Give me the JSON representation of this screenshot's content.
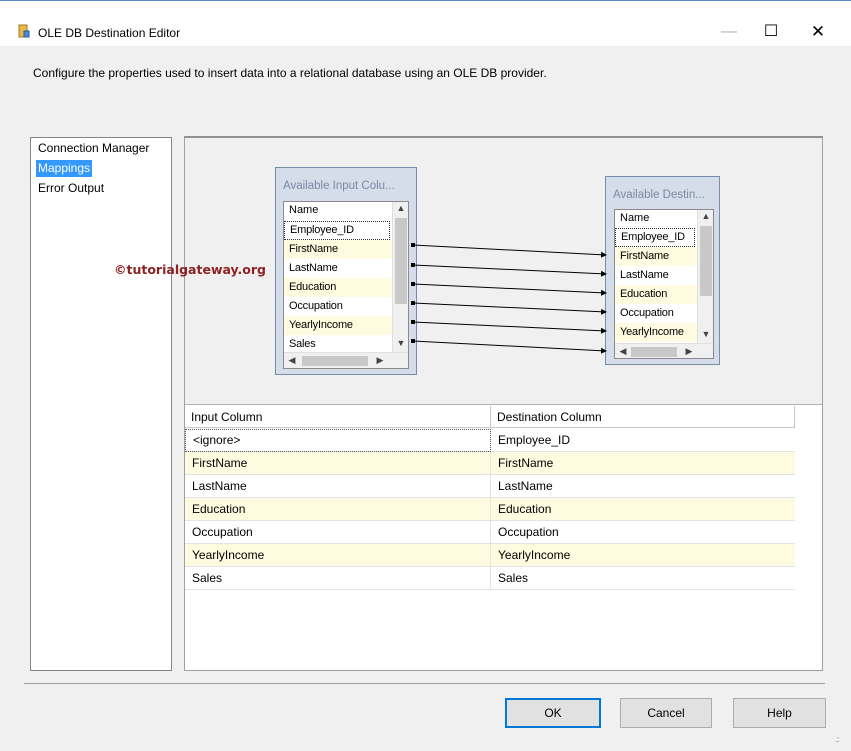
{
  "window": {
    "title": "OLE DB Destination Editor",
    "minimize_glyph": "—",
    "maximize_glyph": "☐",
    "close_glyph": "✕",
    "icon": "ssis-destination-icon"
  },
  "description": "Configure the properties used to insert data into a relational database using an OLE DB provider.",
  "nav": {
    "items": [
      {
        "label": "Connection Manager"
      },
      {
        "label": "Mappings",
        "selected": true
      },
      {
        "label": "Error Output"
      }
    ]
  },
  "watermark": "©tutorialgateway.org",
  "input_box": {
    "title": "Available Input Colu...",
    "header": "Name",
    "rows": [
      "Employee_ID",
      "FirstName",
      "LastName",
      "Education",
      "Occupation",
      "YearlyIncome",
      "Sales"
    ]
  },
  "dest_box": {
    "title": "Available Destin...",
    "header": "Name",
    "rows": [
      "Employee_ID",
      "FirstName",
      "LastName",
      "Education",
      "Occupation",
      "YearlyIncome"
    ]
  },
  "grid": {
    "headers": {
      "input": "Input Column",
      "destination": "Destination Column"
    },
    "rows": [
      {
        "input": "<ignore>",
        "destination": "Employee_ID"
      },
      {
        "input": "FirstName",
        "destination": "FirstName"
      },
      {
        "input": "LastName",
        "destination": "LastName"
      },
      {
        "input": "Education",
        "destination": "Education"
      },
      {
        "input": "Occupation",
        "destination": "Occupation"
      },
      {
        "input": "YearlyIncome",
        "destination": "YearlyIncome"
      },
      {
        "input": "Sales",
        "destination": "Sales"
      }
    ]
  },
  "buttons": {
    "ok": "OK",
    "cancel": "Cancel",
    "help": "Help"
  },
  "scroll_glyphs": {
    "up": "▲",
    "down": "▼",
    "left": "◀",
    "right": "▶"
  },
  "colors": {
    "selection": "#3399ff",
    "alt_row": "#fffbe0",
    "watermark": "#8b2323",
    "default_button_border": "#0078d7"
  }
}
